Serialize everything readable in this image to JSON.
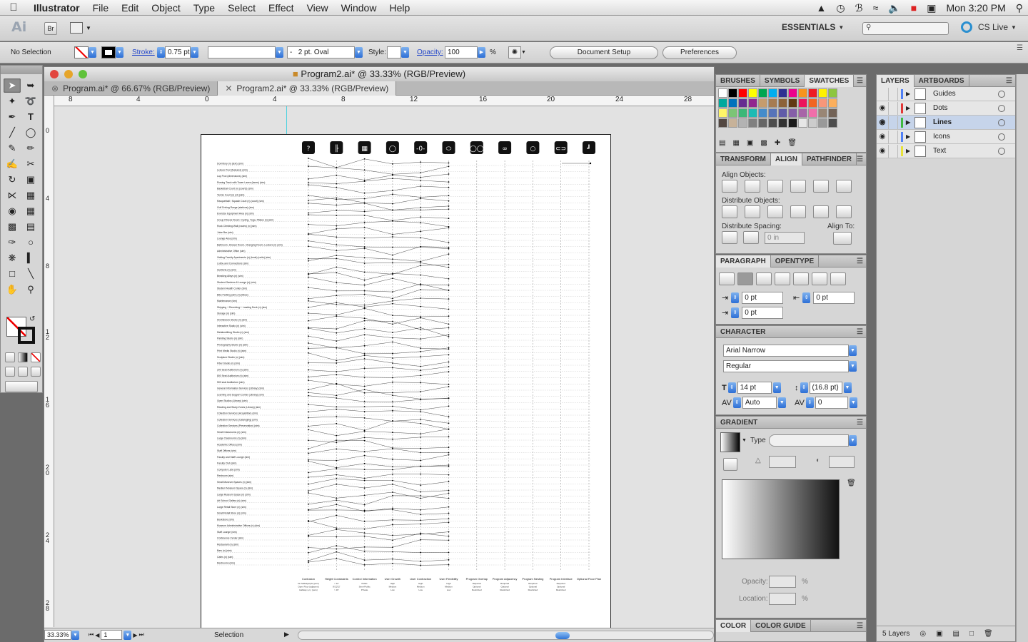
{
  "menubar": {
    "app": "Illustrator",
    "items": [
      "File",
      "Edit",
      "Object",
      "Type",
      "Select",
      "Effect",
      "View",
      "Window",
      "Help"
    ],
    "clock": "Mon 3:20 PM"
  },
  "appbar": {
    "logo": "Ai",
    "bridge": "Br",
    "workspace": "ESSENTIALS",
    "cs_live": "CS Live"
  },
  "controlbar": {
    "selection": "No Selection",
    "stroke_label": "Stroke:",
    "stroke_value": "0.75 pt",
    "brush_value": "2 pt. Oval",
    "brush_prefix": "-",
    "style_label": "Style:",
    "opacity_label": "Opacity:",
    "opacity_value": "100",
    "percent": "%",
    "doc_setup": "Document Setup",
    "preferences": "Preferences"
  },
  "document": {
    "title": "Program2.ai* @ 33.33% (RGB/Preview)",
    "tabs": [
      "Program.ai* @ 66.67% (RGB/Preview)",
      "Program2.ai* @ 33.33% (RGB/Preview)"
    ],
    "zoom": "33.33%",
    "page": "1",
    "status_mode": "Selection",
    "ruler_h": [
      "8",
      "4",
      "0",
      "4",
      "8",
      "12",
      "16",
      "20",
      "24",
      "28"
    ],
    "ruler_v": [
      "0",
      "4",
      "8",
      "1 2",
      "1 6",
      "2 0",
      "2 4",
      "2 8"
    ]
  },
  "artwork": {
    "icons": [
      "?",
      "╟",
      "▦",
      "◯",
      "-0-",
      "⬭",
      "◯◯",
      "∞",
      "○",
      "⊂⊃",
      "┛"
    ],
    "columns": [
      {
        "name": "Confusion",
        "lines": [
          "No hallways/pls (pers)",
          "Open Floor (adjacent)",
          "Hallway (+/-) (pers)"
        ]
      },
      {
        "name": "Height Constraints",
        "lines": [
          "< 12'",
          "8'/12'/2'",
          "> 16'"
        ]
      },
      {
        "name": "Control Information",
        "lines": [
          "Public",
          "Semi-Public",
          "Private"
        ]
      },
      {
        "name": "User Growth",
        "lines": [
          "High",
          "Medium",
          "Low"
        ]
      },
      {
        "name": "User Contraction",
        "lines": [
          "High",
          "Medium",
          "Low"
        ]
      },
      {
        "name": "User Flexibility",
        "lines": [
          "High",
          "Medium",
          "Low"
        ]
      },
      {
        "name": "Program Overlap",
        "lines": [
          "Required",
          "Optional",
          "Restricted"
        ]
      },
      {
        "name": "Program Adjacency",
        "lines": [
          "Required",
          "Optional",
          "Restricted"
        ]
      },
      {
        "name": "Program Nesting",
        "lines": [
          "Required",
          "Optional",
          "Restricted"
        ]
      },
      {
        "name": "Program Interface",
        "lines": [
          "Required",
          "Optional",
          "Restricted"
        ]
      },
      {
        "name": "Optional Floor Plan",
        "lines": []
      }
    ],
    "rows": [
      "Dormitory (n) (text) (sim)",
      "Leisure Pool (features) (sim)",
      "Lap Pool (dimensions) (sim)",
      "Rowing Track with Tower Lanes (lanes) (sim)",
      "Basketball Court (n) (courts) (sim)",
      "Tennis Court (n) (ct) (sim)",
      "Racquetball / Squash Court (n) (court) (sim)",
      "Golf Driving Range (stations) (sim)",
      "Exercise Equipment Area (n) (sim)",
      "Group Fitness Room: Cycling, Yoga, Pilates (n) (sim)",
      "Rock Climbing Wall (routes) (n) (sim)",
      "Juice Bar (sim)",
      "Lounge Area (sim)",
      "Bathroom, Shower Room, Changing Room, Lockers (n) (sim)",
      "Administrative Office (sim)",
      "Visiting Faculty Apartments (n) (beds) (units) (sim)",
      "Lobby and Connections (sim)",
      "Auditoria (n) (sim)",
      "Breaking Alleys (n) (sim)",
      "Student Gardens & Lounge (n) (sim)",
      "Student Health Center (sim)",
      "Bike Parking (sim) (n) (bikes)",
      "Maintenance (sim)",
      "Shipping + Receiving + Loading Dock (n) (sim)",
      "Storage (n) (sim)",
      "Architecture Studio (n) (sim)",
      "Interactive Studio (n) (sim)",
      "Metalsmithing Studio (n) (sim)",
      "Painting Studio (n) (sim)",
      "Photography Studio (n) (sim)",
      "Print Media Studio (n) (sim)",
      "Sculpture Studio (n) (sim)",
      "Fiber Studio (n) (sim)",
      "200 Seat Auditorium (n) (sim)",
      "800 Seat Auditorium (n) (sim)",
      "500 seat Auditorium (sim)",
      "General Information Services (Library) (sim)",
      "Learning and Support Center (Library) (sim)",
      "Open Studios (Library) (sim)",
      "Reading and Study Zones (Library) (sim)",
      "Collection Services (Acquisition) (sim)",
      "Collection Services (Cataloging) (sim)",
      "Collection Services (Preservation) (sim)",
      "Small Classrooms (n) (sim)",
      "Large Classrooms (n) (sim)",
      "Academic Offices (sim)",
      "Staff Offices (sim)",
      "Faculty and Staff Lounge (sim)",
      "Faculty Club (sim)",
      "Computer Labs (sim)",
      "Restroom (sim)",
      "Small Museum Spaces (n) (sim)",
      "Medium Museum Space (n) (sim)",
      "Large Museum Space (n) (sim)",
      "Art School Gallery (n) (sim)",
      "Large Retail Store (n) (sim)",
      "Small Retail Store (n) (sim)",
      "Bookstore (sim)",
      "Museum Administrative Offices (n) (sim)",
      "Staff Lounge (sim)",
      "Conference Center (sim)",
      "Restaurant (n) (sim)",
      "Bars (n) (sim)",
      "Cafes (n) (sim)",
      "Restrooms (sim)"
    ]
  },
  "panels": {
    "swatch_tabs": [
      "BRUSHES",
      "SYMBOLS",
      "SWATCHES"
    ],
    "swatch_colors": [
      "#ffffff",
      "#000000",
      "#ff0000",
      "#ffff00",
      "#00a651",
      "#00aeef",
      "#2e3192",
      "#ec008c",
      "#f7941d",
      "#ed1c24",
      "#fff200",
      "#8dc63f",
      "#00a99d",
      "#0072bc",
      "#662d91",
      "#92278f",
      "#c69c6d",
      "#a67c52",
      "#8c6239",
      "#603913",
      "#ed145b",
      "#f26522",
      "#f7977a",
      "#fbaf5d",
      "#fff568",
      "#7cc576",
      "#3bb878",
      "#1cbbb4",
      "#448ccb",
      "#5674b9",
      "#605ca8",
      "#855fa8",
      "#a864a8",
      "#f06eaa",
      "#998675",
      "#736357",
      "#534741",
      "#c7b299",
      "#b3b3b3",
      "#808080",
      "#666666",
      "#4d4d4d",
      "#333333",
      "#1a1a1a",
      "#e6e6e6",
      "#cccccc",
      "#999999",
      "#4d4d4d"
    ],
    "align_tabs": [
      "TRANSFORM",
      "ALIGN",
      "PATHFINDER"
    ],
    "align_objects": "Align Objects:",
    "distribute_objects": "Distribute Objects:",
    "distribute_spacing": "Distribute Spacing:",
    "align_to": "Align To:",
    "spacing_value": "0 in",
    "paragraph_tabs": [
      "PARAGRAPH",
      "OPENTYPE"
    ],
    "indent_left": "0 pt",
    "indent_right": "0 pt",
    "indent_first": "0 pt",
    "character_title": "CHARACTER",
    "font_family": "Arial Narrow",
    "font_style": "Regular",
    "font_size": "14 pt",
    "leading": "(16.8 pt)",
    "kerning": "Auto",
    "tracking": "0",
    "gradient_title": "GRADIENT",
    "gradient_type_label": "Type",
    "opacity_label": "Opacity:",
    "location_label": "Location:",
    "percent": "%",
    "color_tabs": [
      "COLOR",
      "COLOR GUIDE"
    ]
  },
  "layers": {
    "tabs": [
      "LAYERS",
      "ARTBOARDS"
    ],
    "items": [
      {
        "name": "Guides",
        "color": "#4f7ff5",
        "visible": false,
        "selected": false
      },
      {
        "name": "Dots",
        "color": "#e23838",
        "visible": true,
        "selected": false
      },
      {
        "name": "Lines",
        "color": "#3fb93f",
        "visible": true,
        "selected": true
      },
      {
        "name": "Icons",
        "color": "#4f7ff5",
        "visible": true,
        "selected": false
      },
      {
        "name": "Text",
        "color": "#e8e23a",
        "visible": true,
        "selected": false
      }
    ],
    "count": "5 Layers"
  }
}
